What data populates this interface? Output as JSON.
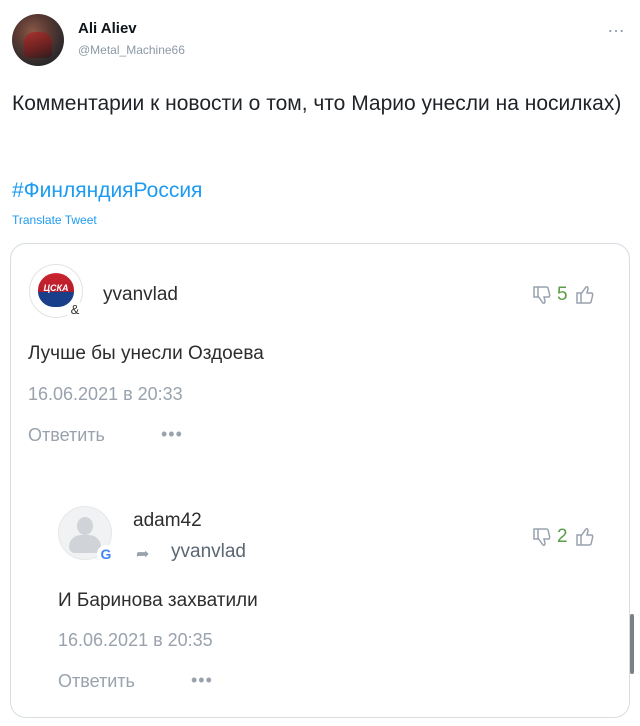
{
  "tweet": {
    "author_name": "Ali Aliev",
    "author_handle": "@Metal_Machine66",
    "more_icon": "…",
    "text": "Комментарии к новости о том, что Марио унесли на носилках)",
    "hashtag": "#ФинляндияРоссия",
    "translate_label": "Translate Tweet"
  },
  "comments": [
    {
      "author": "yvanvlad",
      "avatar_text": "ЦСКА",
      "badge": "&",
      "text": "Лучше бы унесли Оздоева",
      "date": "16.06.2021 в 20:33",
      "reply_label": "Ответить",
      "more_label": "•••",
      "likes": "5"
    },
    {
      "author": "adam42",
      "badge": "G",
      "reply_to": "yvanvlad",
      "text": "И Баринова захватили",
      "date": "16.06.2021 в 20:35",
      "reply_label": "Ответить",
      "more_label": "•••",
      "likes": "2"
    }
  ],
  "colors": {
    "link": "#1d9bf0",
    "like_count": "#5a9c48",
    "muted": "#99a2ad"
  }
}
